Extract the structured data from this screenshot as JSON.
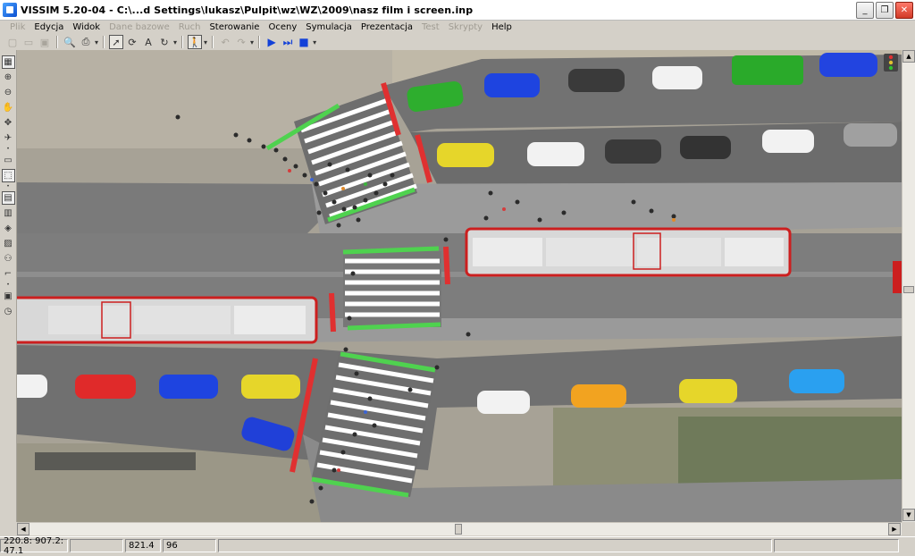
{
  "window": {
    "title": "VISSIM 5.20-04 - C:\\...d Settings\\lukasz\\Pulpit\\wz\\WZ\\2009\\nasz film i screen.inp",
    "controls": [
      "minimize",
      "maximize",
      "close"
    ]
  },
  "menu": {
    "items": [
      {
        "label": "Plik",
        "enabled": false
      },
      {
        "label": "Edycja",
        "enabled": true
      },
      {
        "label": "Widok",
        "enabled": true
      },
      {
        "label": "Dane bazowe",
        "enabled": false
      },
      {
        "label": "Ruch",
        "enabled": false
      },
      {
        "label": "Sterowanie",
        "enabled": true
      },
      {
        "label": "Oceny",
        "enabled": true
      },
      {
        "label": "Symulacja",
        "enabled": true
      },
      {
        "label": "Prezentacja",
        "enabled": true
      },
      {
        "label": "Test",
        "enabled": false
      },
      {
        "label": "Skrypty",
        "enabled": false
      },
      {
        "label": "Help",
        "enabled": true
      }
    ]
  },
  "toolbar": {
    "groups": [
      [
        "new-file-icon",
        "open-file-icon",
        "save-icon"
      ],
      [
        "print-preview-icon",
        "print-icon"
      ],
      [
        "select-pointer-icon",
        "rotate-tool-icon",
        "text-size-icon",
        "rotate-view-icon"
      ],
      [
        "pedestrian-icon"
      ],
      [
        "undo-icon",
        "redo-icon"
      ],
      [
        "play-icon",
        "step-icon",
        "stop-icon"
      ]
    ]
  },
  "left_toolbar": {
    "items": [
      "network-view-icon",
      "zoom-in-icon",
      "zoom-out-icon",
      "pan-hand-icon",
      "rotate-3d-icon",
      "aircraft-icon",
      "rectangle-select-icon",
      "link-edit-icon",
      "grid-icon",
      "node-icon",
      "signal-head-icon",
      "detector-icon",
      "pedestrian-area-icon",
      "ramp-icon",
      "camera-icon",
      "clock-icon"
    ]
  },
  "canvas": {
    "description": "",
    "colors": {
      "road": "#6f6f6f",
      "median": "#8f8f8f",
      "crosswalk": "#ffffff",
      "stop_line_red": "#e03030",
      "stop_line_green": "#4fd24f",
      "tram_body": "#dcdcdc",
      "tram_outline": "#cc1f1f"
    }
  },
  "status": {
    "coordinates": "220.8: 907.2: 47.1",
    "sim_time": "821.4",
    "speed": "96"
  }
}
